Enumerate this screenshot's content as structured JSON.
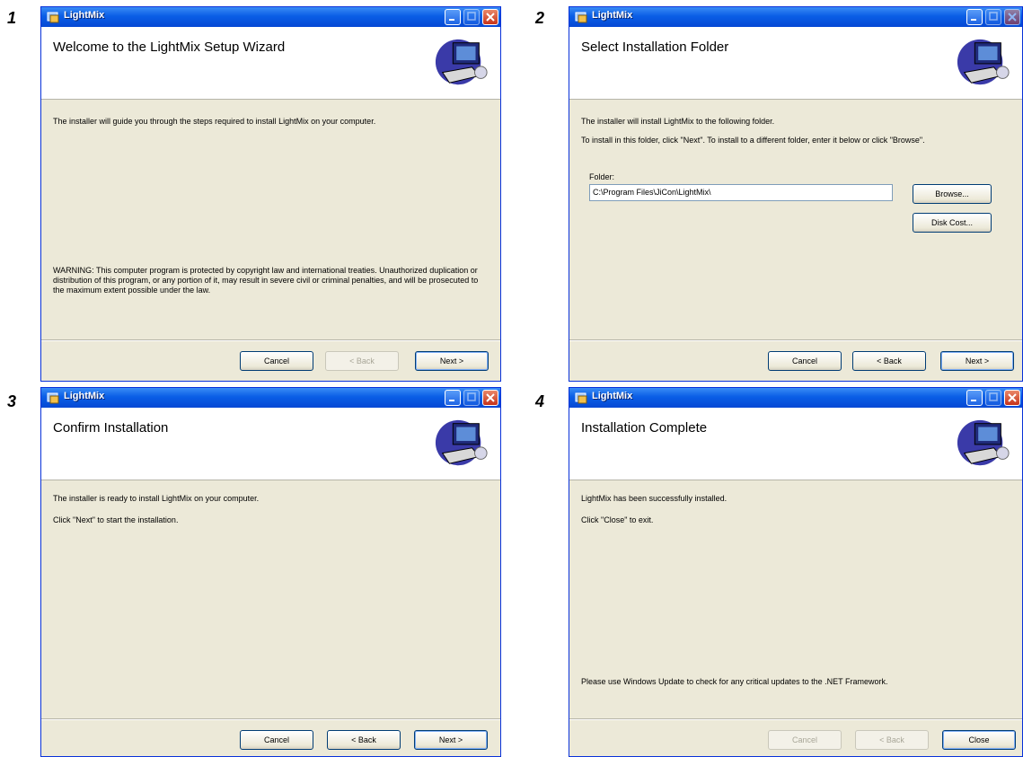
{
  "steps": [
    "1",
    "2",
    "3",
    "4"
  ],
  "app_title": "LightMix",
  "panel1": {
    "heading": "Welcome to the LightMix Setup Wizard",
    "intro": "The installer will guide you through the steps required to install LightMix on your computer.",
    "warning": "WARNING: This computer program is protected by copyright law and international treaties. Unauthorized duplication or distribution of this program, or any portion of it, may result in severe civil or criminal penalties, and will be prosecuted to the maximum extent possible under the law.",
    "buttons": {
      "cancel": "Cancel",
      "back": "< Back",
      "next": "Next >"
    }
  },
  "panel2": {
    "heading": "Select Installation Folder",
    "line1": "The installer will install LightMix to the following folder.",
    "line2": "To install in this folder, click \"Next\". To install to a different folder, enter it below or click \"Browse\".",
    "folder_label": "Folder:",
    "folder_value": "C:\\Program Files\\JiCon\\LightMix\\",
    "browse": "Browse...",
    "disk_cost": "Disk Cost...",
    "buttons": {
      "cancel": "Cancel",
      "back": "< Back",
      "next": "Next >"
    }
  },
  "panel3": {
    "heading": "Confirm Installation",
    "line1": "The installer is ready to install LightMix on your computer.",
    "line2": "Click \"Next\" to start the installation.",
    "buttons": {
      "cancel": "Cancel",
      "back": "< Back",
      "next": "Next >"
    }
  },
  "panel4": {
    "heading": "Installation Complete",
    "line1": "LightMix has been successfully installed.",
    "line2": "Click \"Close\" to exit.",
    "line3": "Please use Windows Update to check for any critical updates to the .NET Framework.",
    "buttons": {
      "cancel": "Cancel",
      "back": "< Back",
      "close": "Close"
    }
  },
  "icons": {
    "app": "installer-app-icon",
    "wizard": "computer-setup-icon",
    "minimize": "minimize-icon",
    "maximize": "maximize-icon",
    "close": "close-icon"
  },
  "colors": {
    "titlebar": "#0a5ee6",
    "dialog_bg": "#ece9d8",
    "close_button": "#c6331a"
  }
}
